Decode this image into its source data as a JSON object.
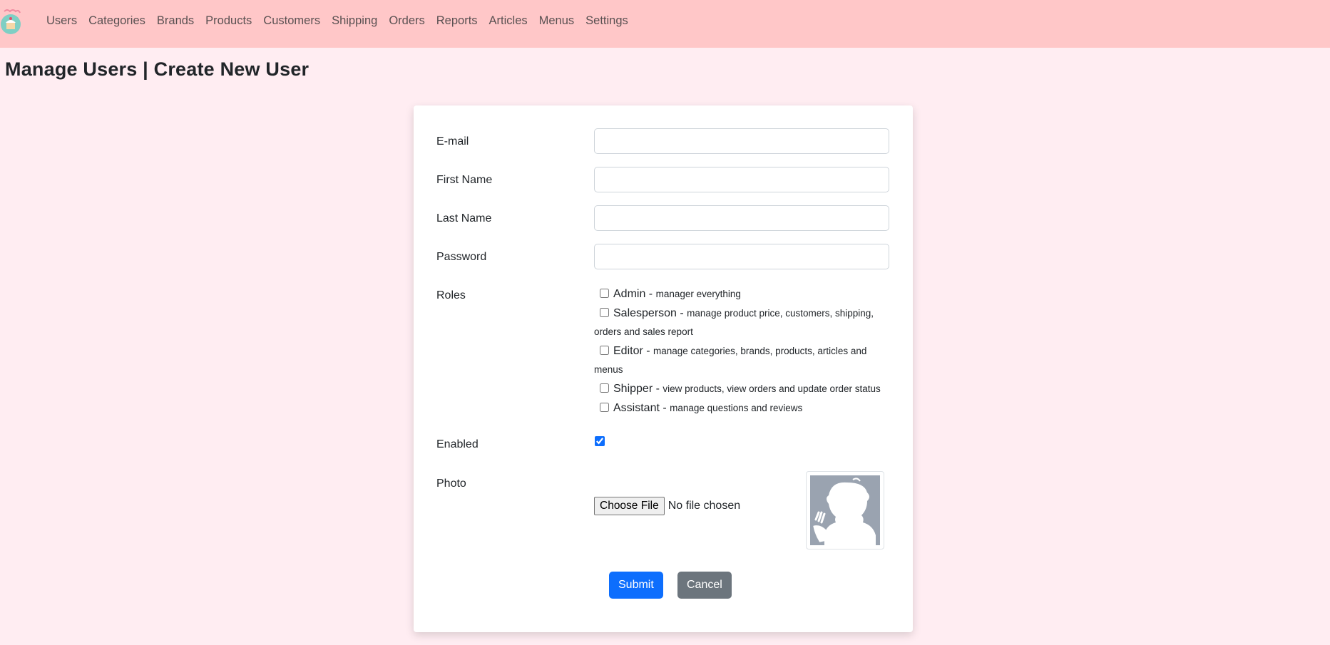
{
  "navbar": {
    "logo_icon": "cupcake-logo-icon",
    "items": [
      "Users",
      "Categories",
      "Brands",
      "Products",
      "Customers",
      "Shipping",
      "Orders",
      "Reports",
      "Articles",
      "Menus",
      "Settings"
    ]
  },
  "page": {
    "title": "Manage Users | Create New User"
  },
  "form": {
    "email_label": "E-mail",
    "email_value": "",
    "first_name_label": "First Name",
    "first_name_value": "",
    "last_name_label": "Last Name",
    "last_name_value": "",
    "password_label": "Password",
    "password_value": "",
    "roles_label": "Roles",
    "roles": [
      {
        "name": "Admin",
        "sep": " - ",
        "description": "manager everything",
        "checked": false
      },
      {
        "name": "Salesperson",
        "sep": " - ",
        "description": "manage product price, customers, shipping, orders and sales report",
        "checked": false
      },
      {
        "name": "Editor",
        "sep": " - ",
        "description": "manage categories, brands, products, articles and menus",
        "checked": false
      },
      {
        "name": "Shipper",
        "sep": " - ",
        "description": "view products, view orders and update order status",
        "checked": false
      },
      {
        "name": "Assistant",
        "sep": " - ",
        "description": "manage questions and reviews",
        "checked": false
      }
    ],
    "enabled_label": "Enabled",
    "enabled_checked": true,
    "photo_label": "Photo",
    "choose_file_label": "Choose File",
    "file_status": "No file chosen",
    "photo_placeholder_icon": "default-user-silhouette-icon",
    "submit_label": "Submit",
    "cancel_label": "Cancel"
  },
  "colors": {
    "navbar_bg": "#ffc7c8",
    "page_bg": "#ffedf2",
    "primary": "#0d6efd",
    "secondary": "#6c757d"
  }
}
